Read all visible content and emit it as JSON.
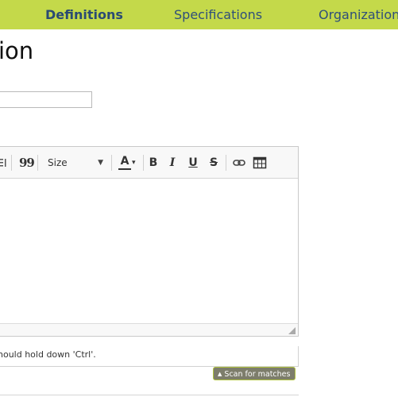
{
  "nav": {
    "items": [
      {
        "label": "Definitions",
        "active": true
      },
      {
        "label": "Specifications",
        "active": false
      },
      {
        "label": "Organization",
        "active": false
      }
    ],
    "background": "#c4d94a"
  },
  "page": {
    "title": "ion"
  },
  "editor": {
    "toolbar": {
      "size_label": "Size",
      "bold_label": "B",
      "italic_label": "I",
      "underline_label": "U",
      "strike_label": "S",
      "font_color_label": "A",
      "quote_label": "99"
    },
    "help_text": "hould hold down 'Ctrl'."
  },
  "scan_button": {
    "label": "Scan for matches",
    "icon": "up-triangle-icon"
  }
}
